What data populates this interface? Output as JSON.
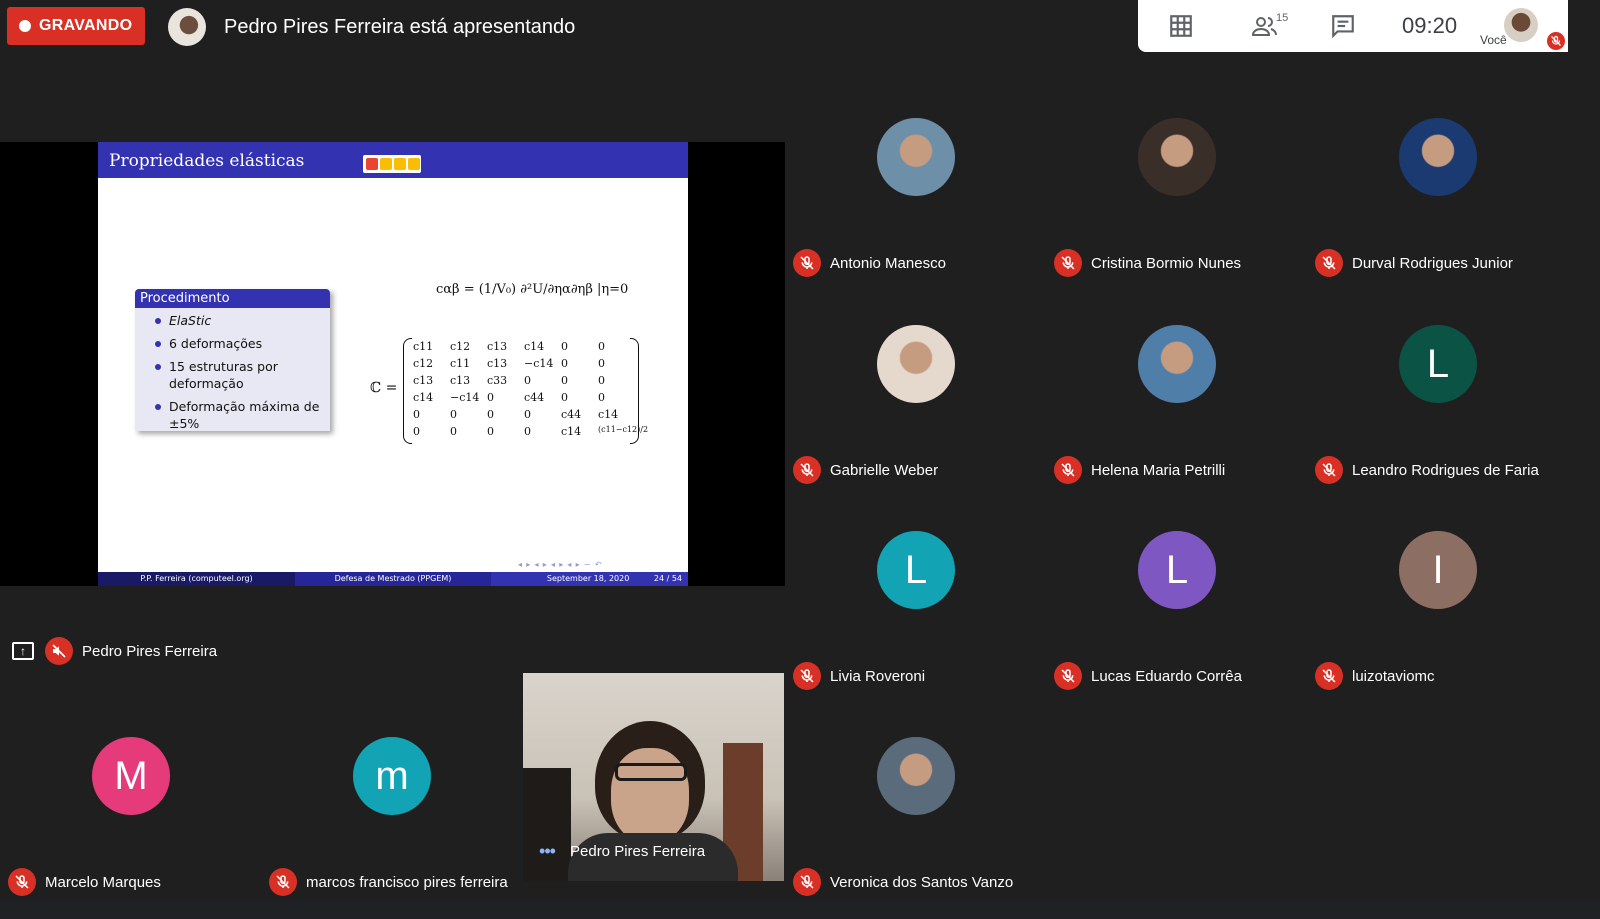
{
  "recording": {
    "label": "GRAVANDO"
  },
  "header": {
    "presenting_text": "Pedro Pires Ferreira está apresentando"
  },
  "top_panel": {
    "participants_count": "15",
    "time": "09:20",
    "self_label": "Você"
  },
  "presentation": {
    "presenter_name": "Pedro Pires Ferreira",
    "slide": {
      "title": "Propriedades elásticas",
      "block_title": "Procedimento",
      "bullets": [
        "ElaStic",
        "6 deformações",
        "15 estruturas por deformação",
        "Deformação máxima de ±5%"
      ],
      "equation_line": "cαβ = (1/V₀) ∂²U/∂ηα∂ηβ |η=0",
      "matrix_label": "ℂ =",
      "matrix": [
        [
          "c11",
          "c12",
          "c13",
          "c14",
          "0",
          "0"
        ],
        [
          "c12",
          "c11",
          "c13",
          "−c14",
          "0",
          "0"
        ],
        [
          "c13",
          "c13",
          "c33",
          "0",
          "0",
          "0"
        ],
        [
          "c14",
          "−c14",
          "0",
          "c44",
          "0",
          "0"
        ],
        [
          "0",
          "0",
          "0",
          "0",
          "c44",
          "c14"
        ],
        [
          "0",
          "0",
          "0",
          "0",
          "c14",
          "(c11−c12)/2"
        ]
      ],
      "footer_left": "P.P. Ferreira  (computeel.org)",
      "footer_center": "Defesa de Mestrado (PPGEM)",
      "footer_date": "September 18, 2020",
      "footer_page": "24 / 54"
    }
  },
  "participants": [
    {
      "name": "Antonio Manesco",
      "type": "photo",
      "color": "#6d8fa8"
    },
    {
      "name": "Cristina Bormio Nunes",
      "type": "photo",
      "color": "#3a2e28"
    },
    {
      "name": "Durval Rodrigues Junior",
      "type": "photo",
      "color": "#1b3a72"
    },
    {
      "name": "Gabrielle Weber",
      "type": "photo",
      "color": "#e5d8cc"
    },
    {
      "name": "Helena Maria Petrilli",
      "type": "photo",
      "color": "#4f7fa8"
    },
    {
      "name": "Leandro Rodrigues de Faria",
      "type": "initial",
      "initial": "L",
      "color": "#0b5345"
    },
    {
      "name": "Livia Roveroni",
      "type": "initial",
      "initial": "L",
      "color": "#12a4b4"
    },
    {
      "name": "Lucas Eduardo Corrêa",
      "type": "initial",
      "initial": "L",
      "color": "#7e57c2"
    },
    {
      "name": "luizotaviomc",
      "type": "initial",
      "initial": "I",
      "color": "#8d6e63"
    },
    {
      "name": "Marcelo Marques",
      "type": "initial",
      "initial": "M",
      "color": "#e63b7a"
    },
    {
      "name": "marcos francisco pires ferreira",
      "type": "initial",
      "initial": "m",
      "color": "#12a4b4"
    },
    {
      "name": "Veronica dos Santos Vanzo",
      "type": "photo",
      "color": "#5a6b7c"
    }
  ],
  "camera_tile": {
    "name": "Pedro Pires Ferreira"
  }
}
